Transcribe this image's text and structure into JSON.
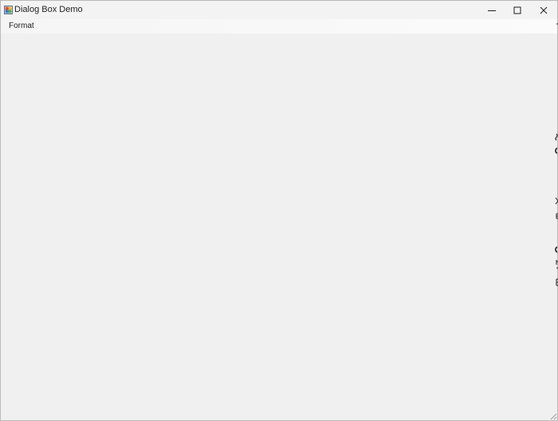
{
  "window": {
    "title": "Dialog Box Demo",
    "icon": "app-icon"
  },
  "caption_buttons": {
    "minimize_icon": "minimize-icon",
    "maximize_icon": "maximize-icon",
    "close_icon": "close-icon"
  },
  "menubar": {
    "items": [
      {
        "label": "Format"
      }
    ]
  },
  "colors": {
    "client_background": "#f0f0f0",
    "titlebar_background": "#f3f3f3",
    "text": "#1f1f1f"
  }
}
